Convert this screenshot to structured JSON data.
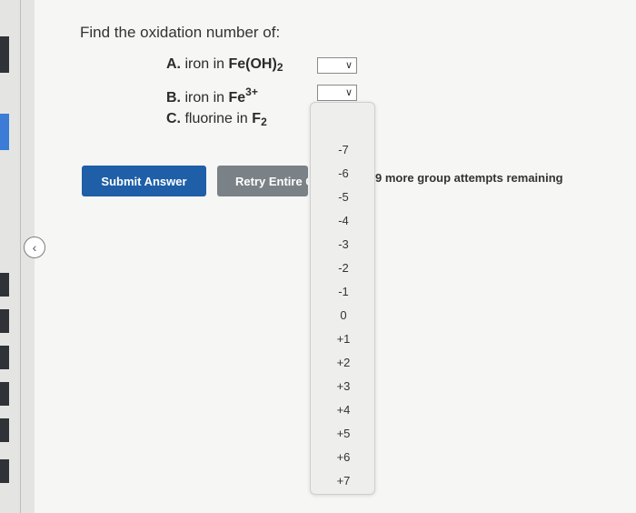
{
  "nav": {
    "icon": "chevron-left-icon"
  },
  "question": {
    "title": "Find the oxidation number of:",
    "items": [
      {
        "letter": "A.",
        "verb": "iron in",
        "formula": "Fe(OH)",
        "sub": "2",
        "sup": ""
      },
      {
        "letter": "B.",
        "verb": "iron in",
        "formula": "Fe",
        "sub": "",
        "sup": "3+"
      },
      {
        "letter": "C.",
        "verb": "fluorine in",
        "formula": "F",
        "sub": "2",
        "sup": ""
      }
    ]
  },
  "selects": {
    "a_value": "",
    "b_value": "",
    "c_status": "✓"
  },
  "buttons": {
    "submit": "Submit Answer",
    "retry": "Retry Entire Group"
  },
  "attempts": "9 more group attempts remaining",
  "dropdown_options": [
    "-7",
    "-6",
    "-5",
    "-4",
    "-3",
    "-2",
    "-1",
    "0",
    "+1",
    "+2",
    "+3",
    "+4",
    "+5",
    "+6",
    "+7"
  ],
  "colors": {
    "submit_bg": "#1e5fa8",
    "retry_bg": "#7a8187"
  }
}
